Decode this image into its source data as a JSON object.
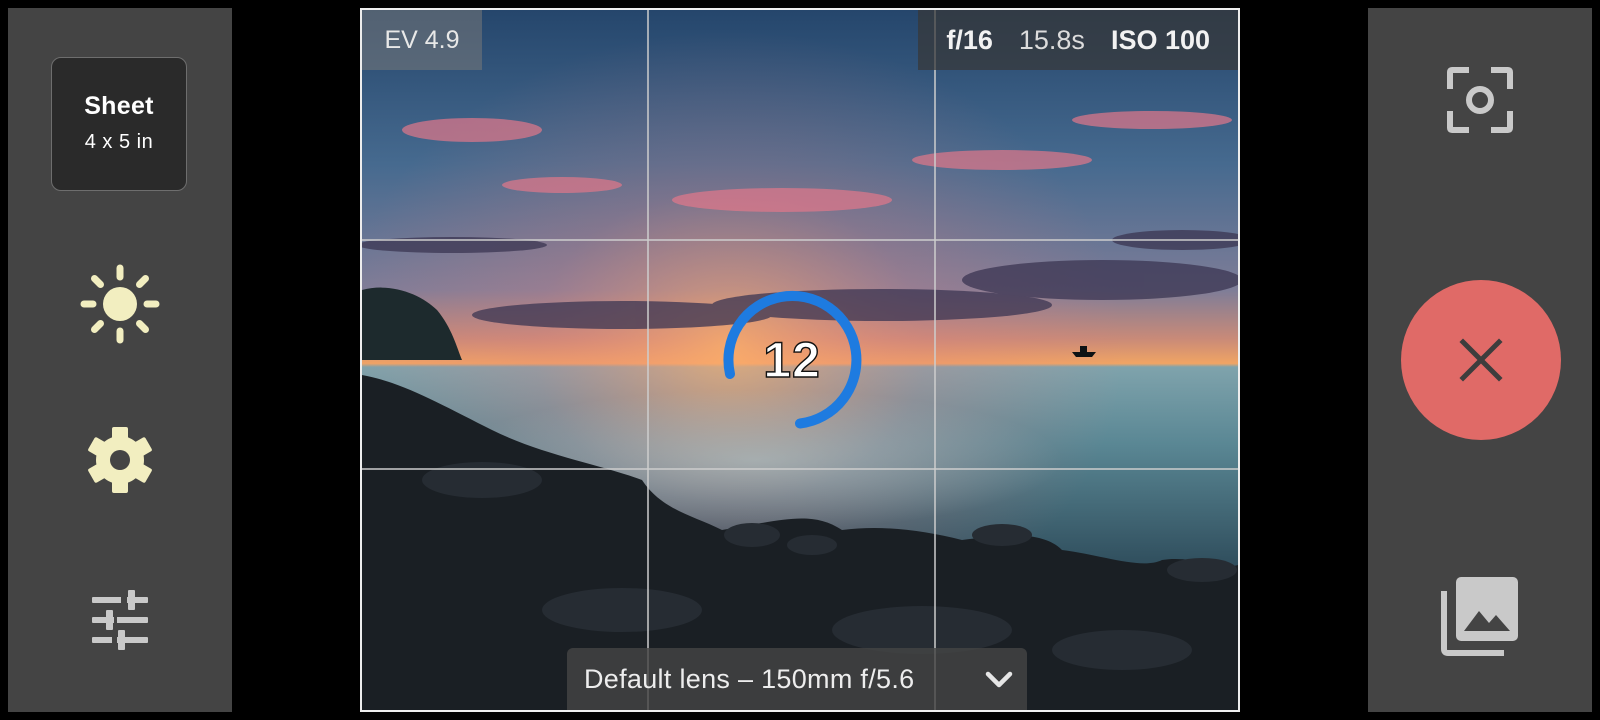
{
  "left_panel": {
    "format": {
      "title": "Sheet",
      "size": "4 x 5 in"
    },
    "brightness_icon": "sun-icon",
    "settings_icon": "gear-icon",
    "adjust_icon": "sliders-icon"
  },
  "viewfinder": {
    "ev": "EV 4.9",
    "aperture": "f/16",
    "shutter": "15.8s",
    "iso": "ISO 100",
    "countdown": "12",
    "lens": "Default lens – 150mm f/5.6",
    "lens_chevron_icon": "chevron-down-icon"
  },
  "right_panel": {
    "focus_icon": "focus-frame-icon",
    "cancel_icon": "close-icon",
    "gallery_icon": "gallery-icon"
  },
  "colors": {
    "panel": "#444444",
    "progress": "#1e7be0",
    "cancel": "#e06a67",
    "icon_light": "#f2eec0",
    "icon_gray": "#c9c9c9"
  }
}
